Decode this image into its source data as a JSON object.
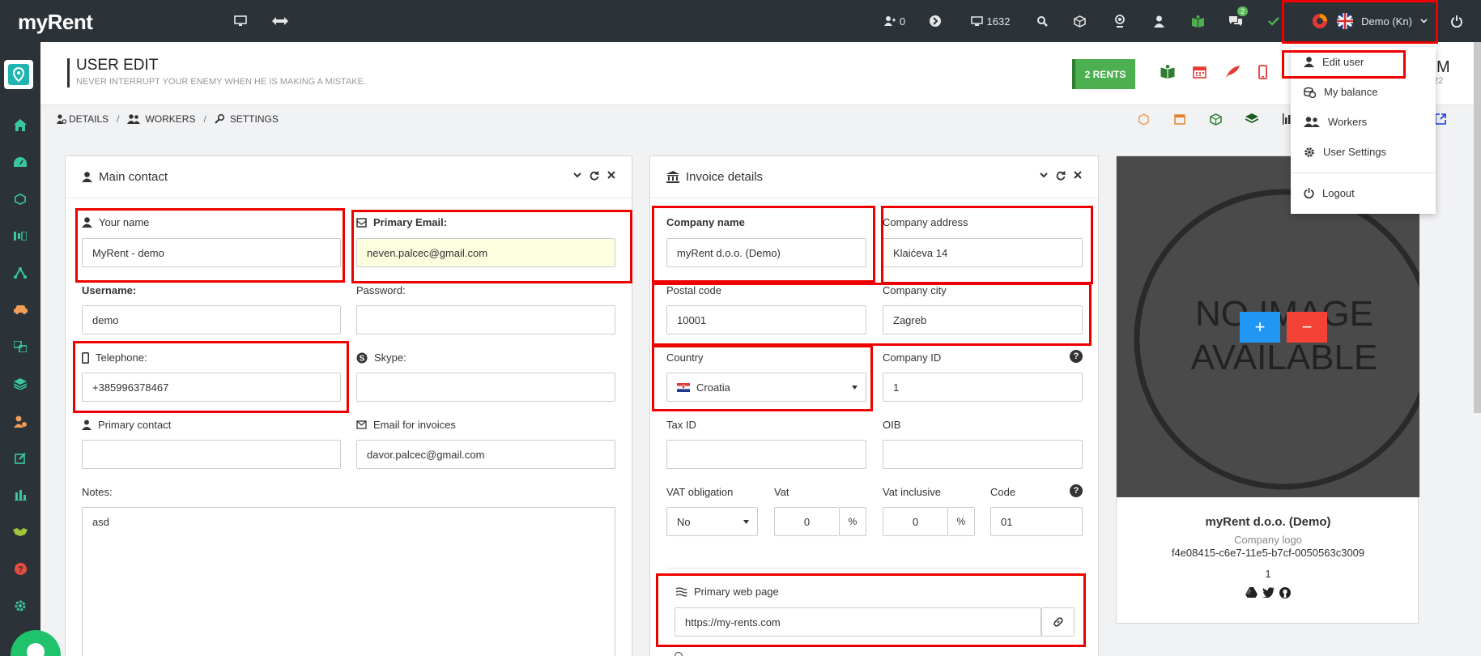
{
  "app": {
    "logo": "myRent"
  },
  "topbar": {
    "users_count": "0",
    "monitor_count": "1632",
    "messages_badge": "2",
    "user_menu_label": "Demo (Kn)"
  },
  "user_menu": {
    "items": [
      "Edit user",
      "My balance",
      "Workers",
      "User Settings"
    ],
    "logout": "Logout"
  },
  "page": {
    "title": "USER EDIT",
    "subtitle": "NEVER INTERRUPT YOUR ENEMY WHEN HE IS MAKING A MISTAKE.",
    "rents_button": "2 RENTS",
    "partial_right_1": "M",
    "partial_right_2": "22"
  },
  "breadcrumbs": {
    "details": "DETAILS",
    "workers": "WORKERS",
    "settings": "SETTINGS",
    "separator": "/"
  },
  "main_contact": {
    "title": "Main contact",
    "your_name_label": "Your name",
    "your_name": "MyRent - demo",
    "primary_email_label": "Primary Email:",
    "primary_email": "neven.palcec@gmail.com",
    "username_label": "Username:",
    "username": "demo",
    "password_label": "Password:",
    "password": "",
    "telephone_label": "Telephone:",
    "telephone": "+385996378467",
    "skype_label": "Skype:",
    "skype": "",
    "primary_contact_label": "Primary contact",
    "primary_contact": "",
    "email_invoices_label": "Email for invoices",
    "email_invoices": "davor.palcec@gmail.com",
    "notes_label": "Notes:",
    "notes": "asd"
  },
  "invoice": {
    "title": "Invoice details",
    "company_name_label": "Company name",
    "company_name": "myRent d.o.o. (Demo)",
    "company_address_label": "Company address",
    "company_address": "Klaićeva 14",
    "postal_code_label": "Postal code",
    "postal_code": "10001",
    "company_city_label": "Company city",
    "company_city": "Zagreb",
    "country_label": "Country",
    "country": "Croatia",
    "company_id_label": "Company ID",
    "company_id": "1",
    "tax_id_label": "Tax ID",
    "tax_id": "",
    "oib_label": "OIB",
    "oib": "",
    "vat_obligation_label": "VAT obligation",
    "vat_obligation": "No",
    "vat_label": "Vat",
    "vat": "0",
    "vat_inclusive_label": "Vat inclusive",
    "vat_inclusive": "0",
    "percent": "%",
    "code_label": "Code",
    "code": "01",
    "help": "?",
    "web_label": "Primary web page",
    "web": "https://my-rents.com"
  },
  "image_card": {
    "no_image_line1": "NO IMAGE",
    "no_image_line2": "AVAILABLE",
    "plus": "+",
    "minus": "−",
    "company": "myRent d.o.o. (Demo)",
    "logo_label": "Company logo",
    "guid": "f4e08415-c6e7-11e5-b7cf-0050563c3009",
    "number": "1"
  },
  "colors": {
    "topbar": "#2c3338",
    "accent_green": "#39c7a2",
    "highlight_red": "#e00000",
    "rents_green": "#4caf50"
  }
}
